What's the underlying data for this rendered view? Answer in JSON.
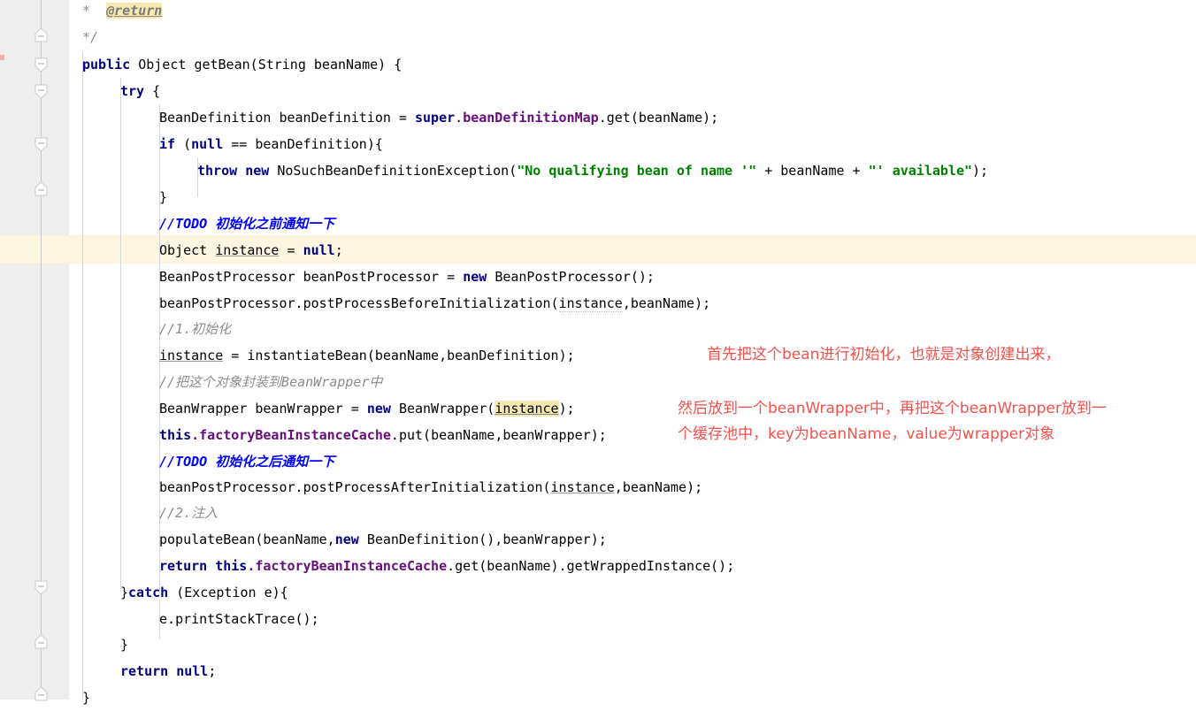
{
  "editor": {
    "language": "java",
    "theme": "IntelliJ Light",
    "font_size_px": 15,
    "line_height_px": 30,
    "colors": {
      "background": "#ffffff",
      "gutter": "#eeeeee",
      "keyword": "#000080",
      "string": "#008000",
      "field": "#660e7a",
      "comment": "#8c8c8c",
      "todo": "#0000ff",
      "caret_line": "#fdf7e2",
      "identifier_highlight": "#f5e8b0",
      "annotation_red": "#f4524d",
      "indent_guide": "#d3d7df",
      "fold_line": "#c9c9c9"
    }
  },
  "code_lines": [
    {
      "id": "l01",
      "text": "     *  @return"
    },
    {
      "id": "l02",
      "text": "     */"
    },
    {
      "id": "l03",
      "text": "    public Object getBean(String beanName) {"
    },
    {
      "id": "l04",
      "text": "        try {"
    },
    {
      "id": "l05",
      "text": "            BeanDefinition beanDefinition = super.beanDefinitionMap.get(beanName);"
    },
    {
      "id": "l06",
      "text": "            if (null == beanDefinition){"
    },
    {
      "id": "l07",
      "text": "                throw new NoSuchBeanDefinitionException(\"No qualifying bean of name '\" + beanName + \"' available\");"
    },
    {
      "id": "l08",
      "text": "            }"
    },
    {
      "id": "l09",
      "text": "            //TODO 初始化之前通知一下"
    },
    {
      "id": "l10",
      "text": "            Object instance = null;"
    },
    {
      "id": "l11",
      "text": "            BeanPostProcessor beanPostProcessor = new BeanPostProcessor();"
    },
    {
      "id": "l12",
      "text": "            beanPostProcessor.postProcessBeforeInitialization(instance,beanName);"
    },
    {
      "id": "l13",
      "text": "            //1.初始化"
    },
    {
      "id": "l14",
      "text": "            instance = instantiateBean(beanName,beanDefinition);"
    },
    {
      "id": "l15",
      "text": "            //把这个对象封装到BeanWrapper中"
    },
    {
      "id": "l16",
      "text": "            BeanWrapper beanWrapper = new BeanWrapper(instance);"
    },
    {
      "id": "l17",
      "text": "            this.factoryBeanInstanceCache.put(beanName,beanWrapper);"
    },
    {
      "id": "l18",
      "text": "            //TODO 初始化之后通知一下"
    },
    {
      "id": "l19",
      "text": "            beanPostProcessor.postProcessAfterInitialization(instance,beanName);"
    },
    {
      "id": "l20",
      "text": "            //2.注入"
    },
    {
      "id": "l21",
      "text": "            populateBean(beanName,new BeanDefinition(),beanWrapper);"
    },
    {
      "id": "l22",
      "text": "            return this.factoryBeanInstanceCache.get(beanName).getWrappedInstance();"
    },
    {
      "id": "l23",
      "text": "        }catch (Exception e){"
    },
    {
      "id": "l24",
      "text": "            e.printStackTrace();"
    },
    {
      "id": "l25",
      "text": "        }"
    },
    {
      "id": "l26",
      "text": "        return null;"
    },
    {
      "id": "l27",
      "text": "    }"
    }
  ],
  "tokens": {
    "javadoc_star": "*",
    "javadoc_return_tag": "@return",
    "javadoc_close": "*/",
    "kw_public": "public",
    "kw_try": "try",
    "kw_if": "if",
    "kw_null": "null",
    "kw_new": "new",
    "kw_throw": "throw",
    "kw_super": "super",
    "kw_this": "this",
    "kw_catch": "catch",
    "kw_return": "return",
    "type_object": "Object",
    "method_getBean": "getBean",
    "type_string": "String",
    "param_beanName": "beanName",
    "type_beanDefinition": "BeanDefinition",
    "var_beanDefinition": "beanDefinition",
    "field_beanDefinitionMap": "beanDefinitionMap",
    "method_get": "get",
    "exception_name": "NoSuchBeanDefinitionException",
    "string_part1": "\"No qualifying bean of name '\"",
    "string_part2": "\"' available\"",
    "var_instance": "instance",
    "type_beanPostProcessor": "BeanPostProcessor",
    "var_beanPostProcessor": "beanPostProcessor",
    "method_postProcessBefore": "postProcessBeforeInitialization",
    "method_instantiateBean": "instantiateBean",
    "type_beanWrapper": "BeanWrapper",
    "var_beanWrapper": "beanWrapper",
    "field_factoryBeanInstanceCache": "factoryBeanInstanceCache",
    "method_put": "put",
    "method_postProcessAfter": "postProcessAfterInitialization",
    "method_populateBean": "populateBean",
    "method_getWrappedInstance": "getWrappedInstance",
    "type_exception": "Exception",
    "var_e": "e",
    "method_printStackTrace": "printStackTrace",
    "comment_todo_before": "//TODO 初始化之前通知一下",
    "comment_step1": "//1.初始化",
    "comment_wrap": "//把这个对象封装到BeanWrapper中",
    "comment_todo_after": "//TODO 初始化之后通知一下",
    "comment_step2": "//2.注入"
  },
  "annotations": [
    {
      "id": "note1",
      "text": "首先把这个bean进行初始化，也就是对象创建出来，"
    },
    {
      "id": "note2",
      "line1": "然后放到一个beanWrapper中，再把这个beanWrapper放到一",
      "line2": "个缓存池中，key为beanName，value为wrapper对象"
    }
  ],
  "fold_markers": [
    {
      "id": "f1",
      "type": "collapse",
      "icon": "fold-collapse-icon"
    },
    {
      "id": "f2",
      "type": "expand",
      "icon": "fold-expand-icon"
    },
    {
      "id": "f3",
      "type": "expand",
      "icon": "fold-expand-icon"
    },
    {
      "id": "f4",
      "type": "expand",
      "icon": "fold-expand-icon"
    },
    {
      "id": "f5",
      "type": "collapse",
      "icon": "fold-collapse-icon"
    },
    {
      "id": "f6",
      "type": "expand",
      "icon": "fold-expand-icon"
    },
    {
      "id": "f7",
      "type": "collapse",
      "icon": "fold-collapse-icon"
    },
    {
      "id": "f8",
      "type": "collapse",
      "icon": "fold-collapse-icon"
    }
  ]
}
